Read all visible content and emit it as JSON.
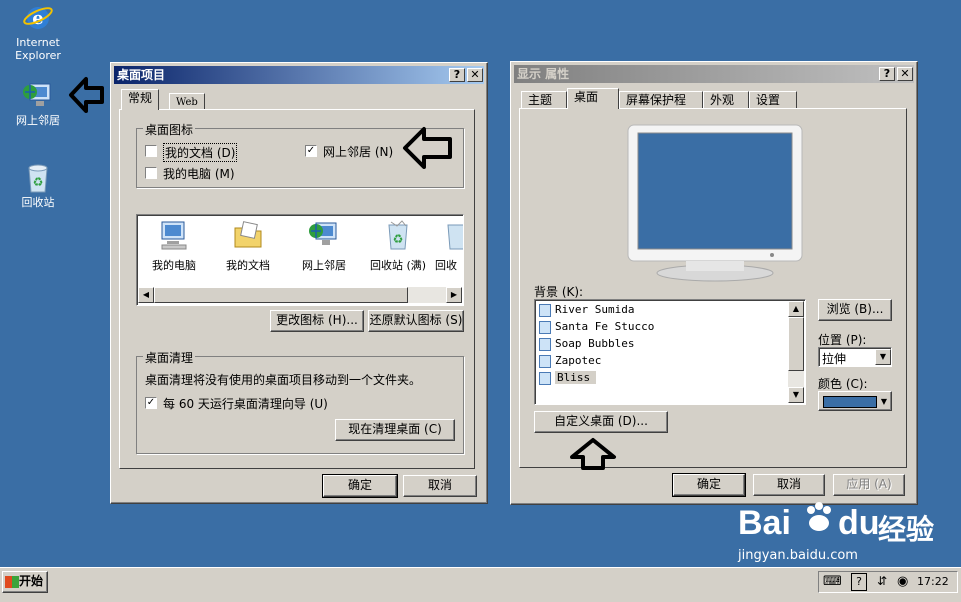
{
  "desktop": {
    "icons": [
      {
        "label": "Internet Explorer",
        "icon": "internet-explorer-icon"
      },
      {
        "label": "网上邻居",
        "icon": "network-places-icon"
      },
      {
        "label": "回收站",
        "icon": "recycle-bin-icon"
      }
    ]
  },
  "desktop_items_dialog": {
    "title": "桌面项目",
    "help_btn": "?",
    "close_btn": "✕",
    "tabs": [
      {
        "label": "常规"
      },
      {
        "label": "Web"
      }
    ],
    "icons_group": {
      "label": "桌面图标",
      "checks": [
        {
          "label": "我的文档 (D)",
          "checked": false
        },
        {
          "label": "我的电脑 (M)",
          "checked": false
        },
        {
          "label": "网上邻居 (N)",
          "checked": true
        }
      ]
    },
    "icon_list": [
      {
        "label": "我的电脑"
      },
      {
        "label": "我的文档"
      },
      {
        "label": "网上邻居"
      },
      {
        "label": "回收站 (满)"
      },
      {
        "label": "回收"
      }
    ],
    "change_icon_btn": "更改图标 (H)...",
    "restore_default_btn": "还原默认图标 (S)",
    "cleanup_group": {
      "label": "桌面清理",
      "description": "桌面清理将没有使用的桌面项目移动到一个文件夹。",
      "check_label": "每 60 天运行桌面清理向导 (U)",
      "checked": true,
      "run_now_btn": "现在清理桌面 (C)"
    },
    "ok_btn": "确定",
    "cancel_btn": "取消"
  },
  "display_properties": {
    "title": "显示 属性",
    "help_btn": "?",
    "close_btn": "✕",
    "tabs": [
      {
        "label": "主题"
      },
      {
        "label": "桌面"
      },
      {
        "label": "屏幕保护程序"
      },
      {
        "label": "外观"
      },
      {
        "label": "设置"
      }
    ],
    "background_label": "背景 (K):",
    "backgrounds": [
      {
        "label": "River Sumida"
      },
      {
        "label": "Santa Fe Stucco"
      },
      {
        "label": "Soap Bubbles"
      },
      {
        "label": "Zapotec"
      },
      {
        "label": "Bliss"
      }
    ],
    "browse_btn": "浏览 (B)...",
    "position_label": "位置 (P):",
    "position_value": "拉伸",
    "color_label": "颜色 (C):",
    "color_value": "#3a6ea5",
    "customize_btn": "自定义桌面 (D)...",
    "ok_btn": "确定",
    "cancel_btn": "取消",
    "apply_btn": "应用 (A)"
  },
  "taskbar": {
    "start_label": "开始",
    "clock": "17:22"
  },
  "watermark": {
    "brand": "Bai",
    "brand2": "du",
    "cn": "经验",
    "url": "jingyan.baidu.com"
  },
  "colors": {
    "desktop": "#3a6ea5",
    "title_active": "#0a246a",
    "window": "#d4d0c8"
  }
}
